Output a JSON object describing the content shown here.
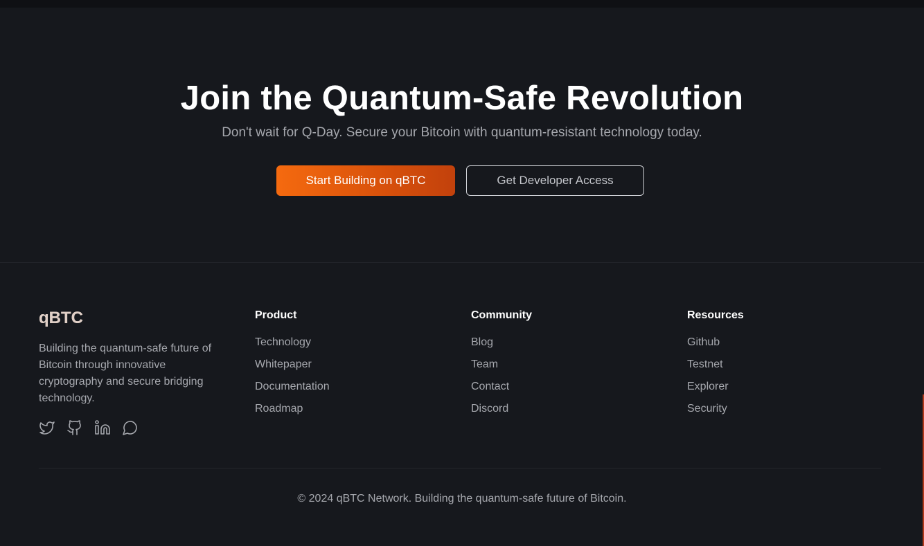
{
  "cta": {
    "title": "Join the Quantum-Safe Revolution",
    "subtitle": "Don't wait for Q-Day. Secure your Bitcoin with quantum-resistant technology today.",
    "primary_button": "Start Building on qBTC",
    "secondary_button": "Get Developer Access"
  },
  "footer": {
    "brand": "qBTC",
    "description": "Building the quantum-safe future of Bitcoin through innovative cryptography and secure bridging technology.",
    "socials": [
      "twitter-icon",
      "github-icon",
      "linkedin-icon",
      "discord-icon"
    ],
    "columns": [
      {
        "title": "Product",
        "links": [
          "Technology",
          "Whitepaper",
          "Documentation",
          "Roadmap"
        ]
      },
      {
        "title": "Community",
        "links": [
          "Blog",
          "Team",
          "Contact",
          "Discord"
        ]
      },
      {
        "title": "Resources",
        "links": [
          "Github",
          "Testnet",
          "Explorer",
          "Security"
        ]
      }
    ],
    "copyright": "© 2024 qBTC Network. Building the quantum-safe future of Bitcoin."
  },
  "colors": {
    "background": "#16181d",
    "accent": "#f56a0f",
    "muted_text": "#a6a8ae"
  }
}
